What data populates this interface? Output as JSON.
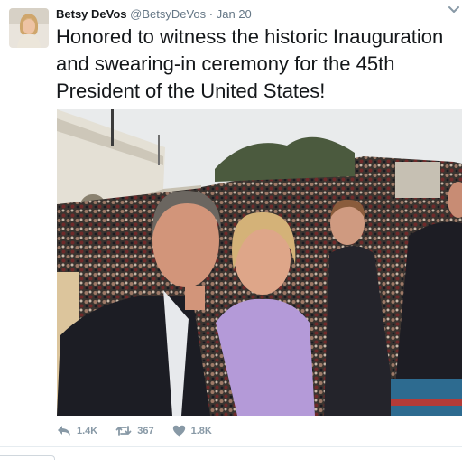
{
  "tweet": {
    "author_name": "Betsy DeVos",
    "handle": "@BetsyDeVos",
    "separator": "·",
    "date": "Jan 20",
    "text": "Honored to witness the historic Inauguration and swearing-in ceremony for the 45th President of the United States!"
  },
  "actions": {
    "reply_count": "1.4K",
    "retweet_count": "367",
    "like_count": "1.8K"
  },
  "icons": {
    "reply": "reply-icon",
    "retweet": "retweet-icon",
    "like": "heart-icon",
    "more": "chevron-down-icon"
  },
  "colors": {
    "text": "#14171a",
    "muted": "#657786",
    "action_gray": "#8899a6",
    "jacket_lavender": "#b49ad8"
  }
}
